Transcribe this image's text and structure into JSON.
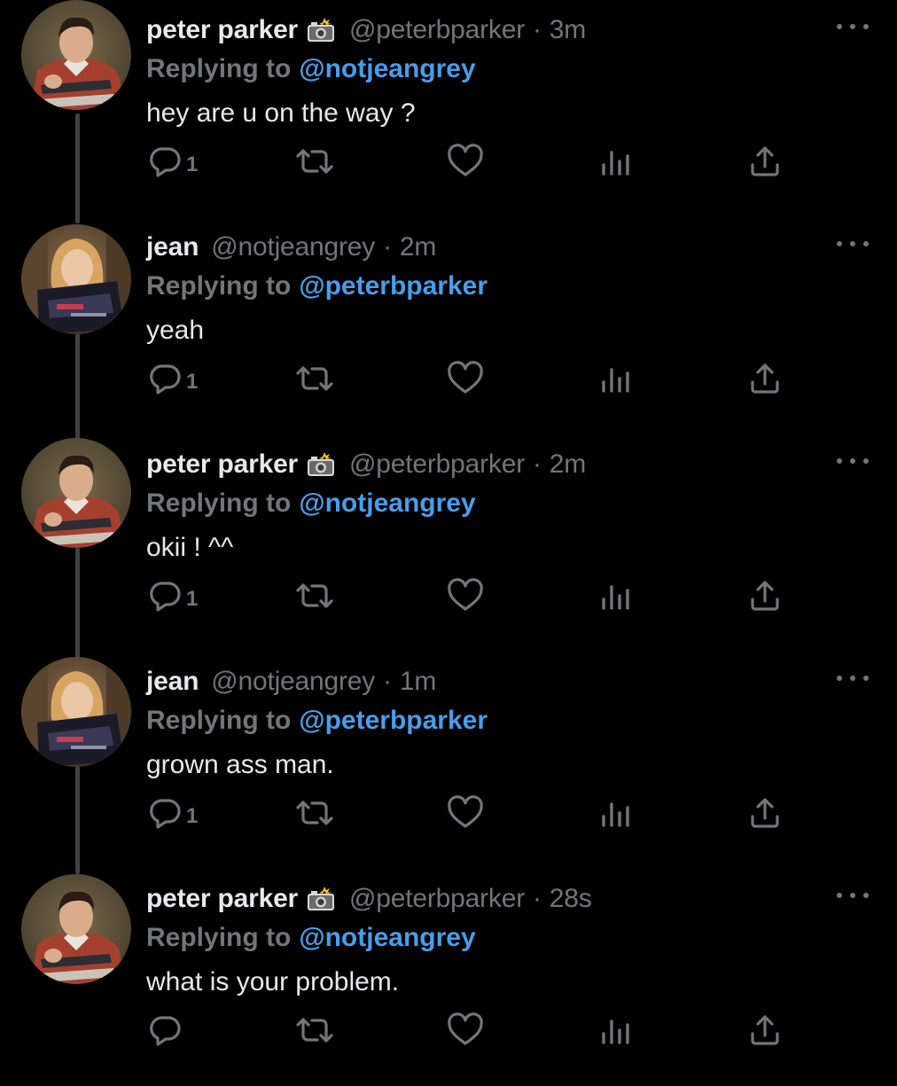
{
  "thread": {
    "tweets": [
      {
        "name": "peter parker",
        "badge_icon": "camera-flash-icon",
        "handle": "@peterbparker",
        "separator": "·",
        "time": "3m",
        "replying_label": "Replying to",
        "replying_to": "@notjeangrey",
        "text": "hey are u on the way ?",
        "reply_count": "1"
      },
      {
        "name": "jean",
        "badge_icon": "",
        "handle": "@notjeangrey",
        "separator": "·",
        "time": "2m",
        "replying_label": "Replying to",
        "replying_to": "@peterbparker",
        "text": "yeah",
        "reply_count": "1"
      },
      {
        "name": "peter parker",
        "badge_icon": "camera-flash-icon",
        "handle": "@peterbparker",
        "separator": "·",
        "time": "2m",
        "replying_label": "Replying to",
        "replying_to": "@notjeangrey",
        "text": "okii ! ^^",
        "reply_count": "1"
      },
      {
        "name": "jean",
        "badge_icon": "",
        "handle": "@notjeangrey",
        "separator": "·",
        "time": "1m",
        "replying_label": "Replying to",
        "replying_to": "@peterbparker",
        "text": "grown ass man.",
        "reply_count": "1"
      },
      {
        "name": "peter parker",
        "badge_icon": "camera-flash-icon",
        "handle": "@peterbparker",
        "separator": "·",
        "time": "28s",
        "replying_label": "Replying to",
        "replying_to": "@notjeangrey",
        "text": "what is your problem.",
        "reply_count": ""
      }
    ]
  },
  "icons": {
    "reply": "reply-icon",
    "retweet": "retweet-icon",
    "like": "like-icon",
    "analytics": "analytics-icon",
    "share": "share-icon",
    "more": "more-icon"
  },
  "colors": {
    "background": "#000000",
    "text_primary": "#e7e9ea",
    "text_secondary": "#71767b",
    "mention": "#4a9de8",
    "thread_line": "#3d4144"
  }
}
